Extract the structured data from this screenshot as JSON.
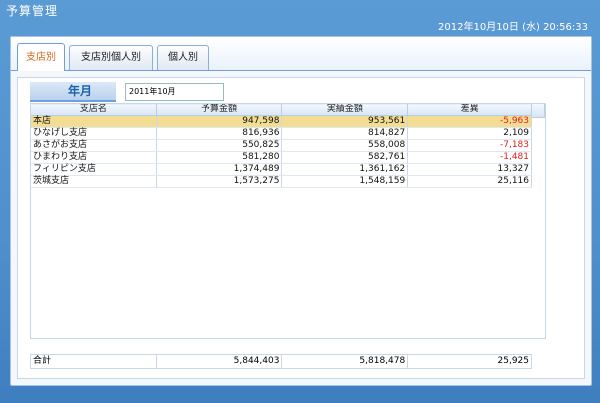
{
  "app": {
    "title": "予算管理",
    "datetime": "2012年10月10日 (水) 20:56:33"
  },
  "tabs": [
    {
      "label": "支店別",
      "active": true
    },
    {
      "label": "支店別個人別",
      "active": false
    },
    {
      "label": "個人別",
      "active": false
    }
  ],
  "filter": {
    "label": "年月",
    "value": "2011年10月"
  },
  "table": {
    "columns": [
      "支店名",
      "予算金額",
      "実績金額",
      "差異"
    ],
    "rows": [
      {
        "branch": "本店",
        "budget": "947,598",
        "actual": "953,561",
        "diff": "-5,963",
        "selected": true
      },
      {
        "branch": "ひなげし支店",
        "budget": "816,936",
        "actual": "814,827",
        "diff": "2,109"
      },
      {
        "branch": "あさがお支店",
        "budget": "550,825",
        "actual": "558,008",
        "diff": "-7,183"
      },
      {
        "branch": "ひまわり支店",
        "budget": "581,280",
        "actual": "582,761",
        "diff": "-1,481"
      },
      {
        "branch": "フィリピン支店",
        "budget": "1,374,489",
        "actual": "1,361,162",
        "diff": "13,327"
      },
      {
        "branch": "茨城支店",
        "budget": "1,573,275",
        "actual": "1,548,159",
        "diff": "25,116"
      }
    ]
  },
  "totals": {
    "label": "合計",
    "budget": "5,844,403",
    "actual": "5,818,478",
    "diff": "25,925"
  },
  "colors": {
    "accent": "#4f8fcc",
    "negative": "#e02020",
    "selection": "#f3dd93",
    "active_tab_text": "#d06a1a"
  }
}
